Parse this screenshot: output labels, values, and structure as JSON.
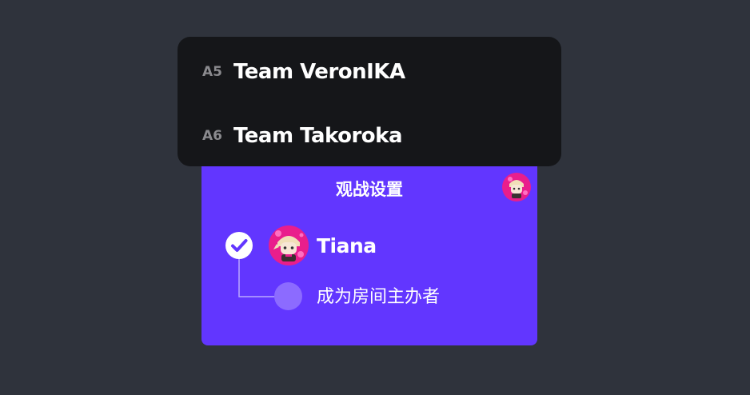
{
  "dropdown": {
    "items": [
      {
        "code": "A5",
        "team": "Team VeronIKA"
      },
      {
        "code": "A6",
        "team": "Team Takoroka"
      }
    ]
  },
  "panel": {
    "title": "观战设置",
    "player": {
      "name": "Tiana",
      "checked": true
    },
    "option": {
      "label": "成为房间主办者",
      "selected": false
    }
  },
  "colors": {
    "page_bg": "#2f333c",
    "panel_bg": "#6236ff",
    "dropdown_bg": "#151619",
    "radio_off": "#8c6bff",
    "avatar_pink": "#e91e8c"
  },
  "icons": {
    "check": "check-circle-icon",
    "avatar": "player-avatar-icon"
  }
}
